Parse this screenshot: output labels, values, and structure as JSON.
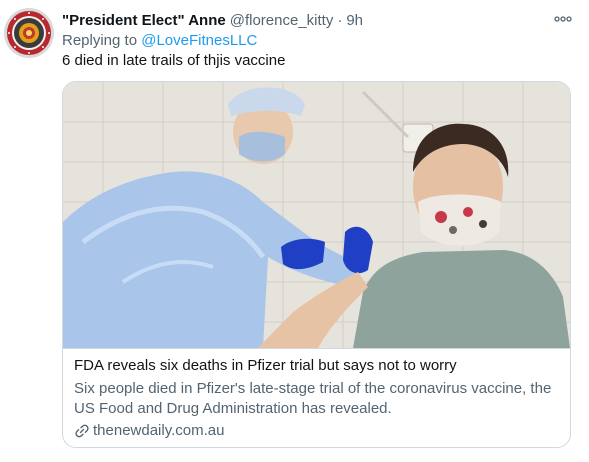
{
  "tweet": {
    "display_name": "\"President Elect\" Anne",
    "handle": "@florence_kitty",
    "separator": "·",
    "time": "9h",
    "replying_prefix": "Replying to",
    "replying_to": "@LoveFitnesLLC",
    "text": "6 died in late trails of thjis vaccine",
    "avatar_icon": "seal-logo-icon",
    "more_icon": "more-options-icon"
  },
  "card": {
    "title": "FDA reveals six deaths in Pfizer trial but says not to worry",
    "description": "Six people died in Pfizer's late-stage trial of the coronavirus vaccine, the US Food and Drug Administration has revealed.",
    "domain": "thenewdaily.com.au",
    "link_icon": "link-icon"
  },
  "colors": {
    "primary_text": "#0f1419",
    "secondary_text": "#536471",
    "accent": "#1d9bf0",
    "border": "#cfd9de"
  }
}
